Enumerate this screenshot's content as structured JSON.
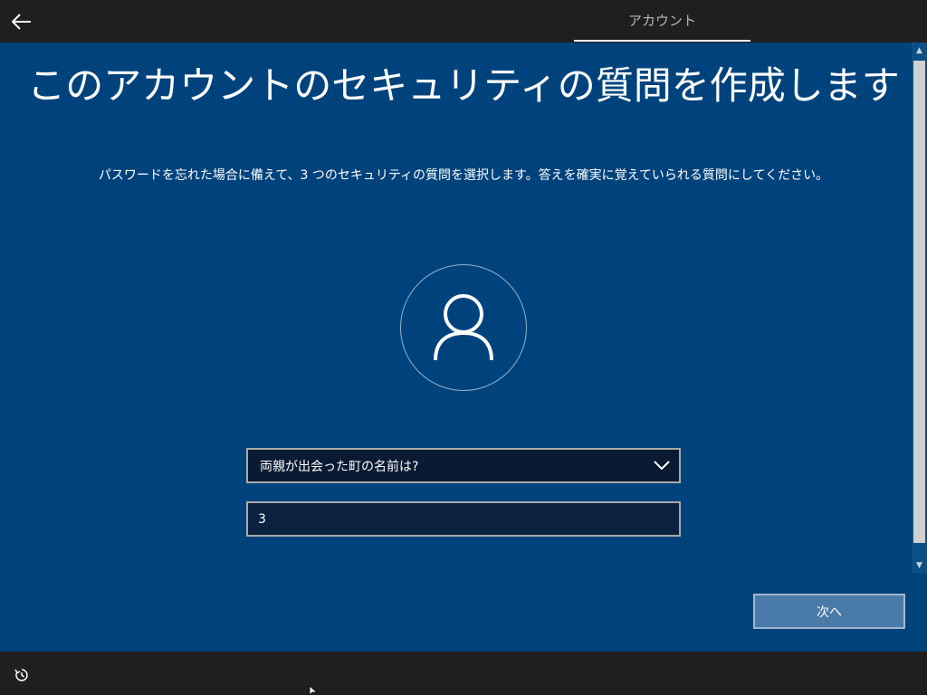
{
  "header": {
    "back_icon": "arrow-left-icon",
    "tab_label": "アカウント"
  },
  "main": {
    "title": "このアカウントのセキュリティの質問を作成します",
    "subtitle": "パスワードを忘れた場合に備えて、3 つのセキュリティの質問を選択します。答えを確実に覚えていられる質問にしてください。",
    "avatar_icon": "user-icon",
    "question": {
      "selected": "両親が出会った町の名前は?",
      "icon": "chevron-down-icon"
    },
    "answer": {
      "value": "3"
    },
    "next_label": "次へ"
  },
  "footer": {
    "ease_icon": "ease-of-access-icon"
  },
  "colors": {
    "background": "#00437c",
    "bar": "#1f1f1f",
    "button": "#4a7ba8"
  }
}
